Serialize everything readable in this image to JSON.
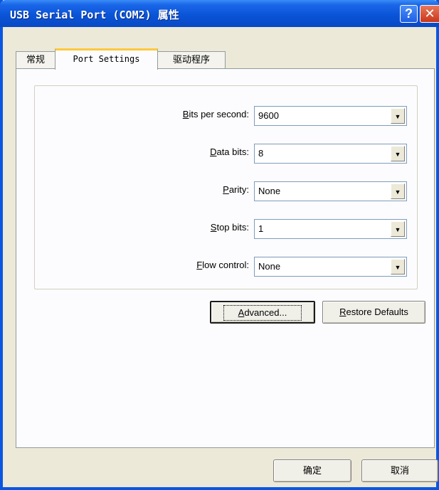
{
  "window": {
    "title": "USB Serial Port (COM2) 属性",
    "help_glyph": "?",
    "close_glyph": "✕"
  },
  "tabs": [
    {
      "label": "常规",
      "active": false
    },
    {
      "label": "Port Settings",
      "active": true
    },
    {
      "label": "驱动程序",
      "active": false
    }
  ],
  "port_settings": {
    "bits_per_second": {
      "accesskey": "B",
      "label_rest": "its per second:",
      "value": "9600"
    },
    "data_bits": {
      "accesskey": "D",
      "label_rest": "ata bits:",
      "value": "8"
    },
    "parity": {
      "accesskey": "P",
      "label_rest": "arity:",
      "value": "None"
    },
    "stop_bits": {
      "accesskey": "S",
      "label_rest": "top bits:",
      "value": "1"
    },
    "flow_control": {
      "accesskey": "F",
      "label_rest": "low control:",
      "value": "None"
    }
  },
  "buttons": {
    "advanced_prefix": "",
    "advanced_accesskey": "A",
    "advanced_rest": "dvanced...",
    "restore_accesskey": "R",
    "restore_rest": "estore Defaults",
    "ok": "确定",
    "cancel": "取消"
  },
  "icons": {
    "combo_arrow": "dropdown-arrow-icon",
    "arrow_glyph": "▼"
  }
}
